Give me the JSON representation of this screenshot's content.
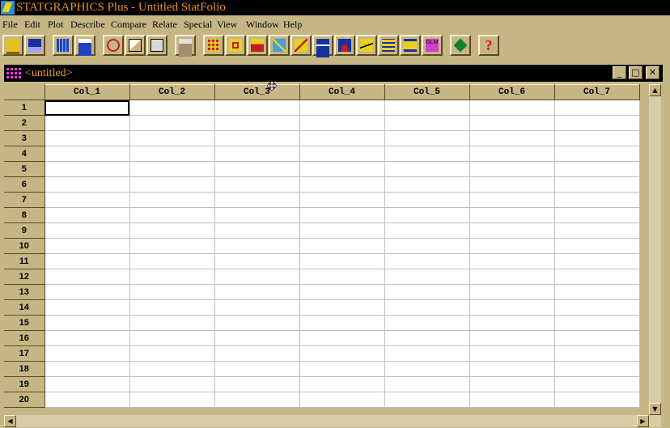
{
  "app": {
    "title": "STATGRAPHICS Plus - Untitled StatFolio"
  },
  "menu": [
    "File",
    "Edit",
    "Plot",
    "Describe",
    "Compare",
    "Relate",
    "Special",
    "View",
    "Window",
    "Help"
  ],
  "toolbar": {
    "buttons": [
      "open-icon",
      "save-icon",
      "datasheet-icon",
      "calculator-icon",
      "cut-icon",
      "copy-icon",
      "paste-icon",
      "print-icon",
      "scatterplot-icon",
      "boxplot-icon",
      "histogram-icon",
      "matrix-plot-icon",
      "xy-plot-icon",
      "time-sequence-icon",
      "distribution-icon",
      "regression-icon",
      "surface-icon",
      "tree-icon",
      "glm-icon",
      "statadvisor-icon",
      "help-icon"
    ],
    "glm_label": "GLM",
    "help_label": "?"
  },
  "document": {
    "title": "<untitled>",
    "columns": [
      "Col_1",
      "Col_2",
      "Col_3",
      "Col_4",
      "Col_5",
      "Col_6",
      "Col_7"
    ],
    "rows": [
      "1",
      "2",
      "3",
      "4",
      "5",
      "6",
      "7",
      "8",
      "9",
      "10",
      "11",
      "12",
      "13",
      "14",
      "15",
      "16",
      "17",
      "18",
      "19",
      "20"
    ]
  },
  "colors": {
    "chrome": "#c6b686",
    "title_text": "#e89020",
    "titlebar": "#000000"
  }
}
